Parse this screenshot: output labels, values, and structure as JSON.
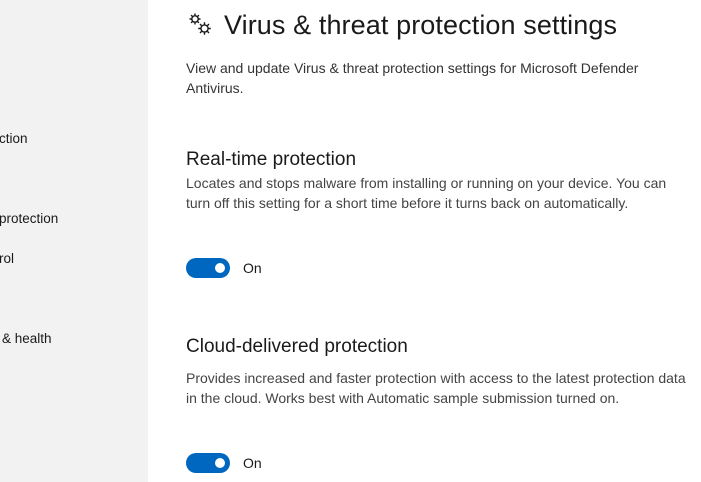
{
  "sidebar": {
    "items": [
      {
        "label": "ction"
      },
      {
        "label": "protection"
      },
      {
        "label": "rol"
      },
      {
        "label": "& health"
      }
    ]
  },
  "header": {
    "icon": "gears-icon",
    "title": "Virus & threat protection settings",
    "description": "View and update Virus & threat protection settings for Microsoft Defender Antivirus."
  },
  "sections": [
    {
      "title": "Real-time protection",
      "description": "Locates and stops malware from installing or running on your device. You can turn off this setting for a short time before it turns back on automatically.",
      "toggle_state": "On"
    },
    {
      "title": "Cloud-delivered protection",
      "description": "Provides increased and faster protection with access to the latest protection data in the cloud. Works best with Automatic sample submission turned on.",
      "toggle_state": "On"
    }
  ],
  "colors": {
    "accent": "#0067c0",
    "sidebar_bg": "#f2f2f2"
  }
}
